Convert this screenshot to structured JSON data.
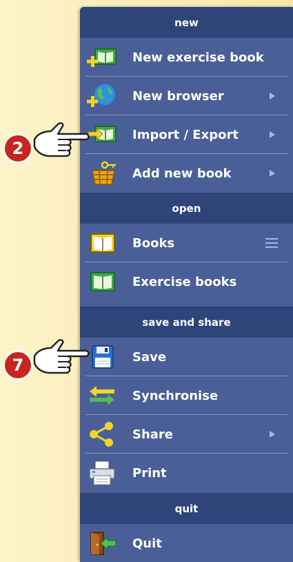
{
  "sections": {
    "new": "new",
    "open": "open",
    "save_share": "save and share",
    "quit": "quit"
  },
  "items": {
    "new_exercise_book": "New exercise book",
    "new_browser": "New browser",
    "import_export": "Import / Export",
    "add_new_book": "Add new book",
    "books": "Books",
    "exercise_books": "Exercise books",
    "save": "Save",
    "synchronise": "Synchronise",
    "share": "Share",
    "print": "Print",
    "quit": "Quit"
  },
  "callouts": {
    "first": "2",
    "second": "7"
  },
  "colors": {
    "menu_bg": "#4a5f97",
    "header_bg": "#2f4479",
    "badge": "#c8251e",
    "book_green": "#3fa84a",
    "book_yellow": "#f1d42b"
  },
  "icons": [
    "new-exercise-book-icon",
    "globe-plus-icon",
    "import-export-icon",
    "basket-keys-icon",
    "book-icon",
    "exercise-book-icon",
    "floppy-disk-icon",
    "sync-arrows-icon",
    "share-icon",
    "printer-icon",
    "exit-door-icon",
    "pointing-hand-icon"
  ]
}
